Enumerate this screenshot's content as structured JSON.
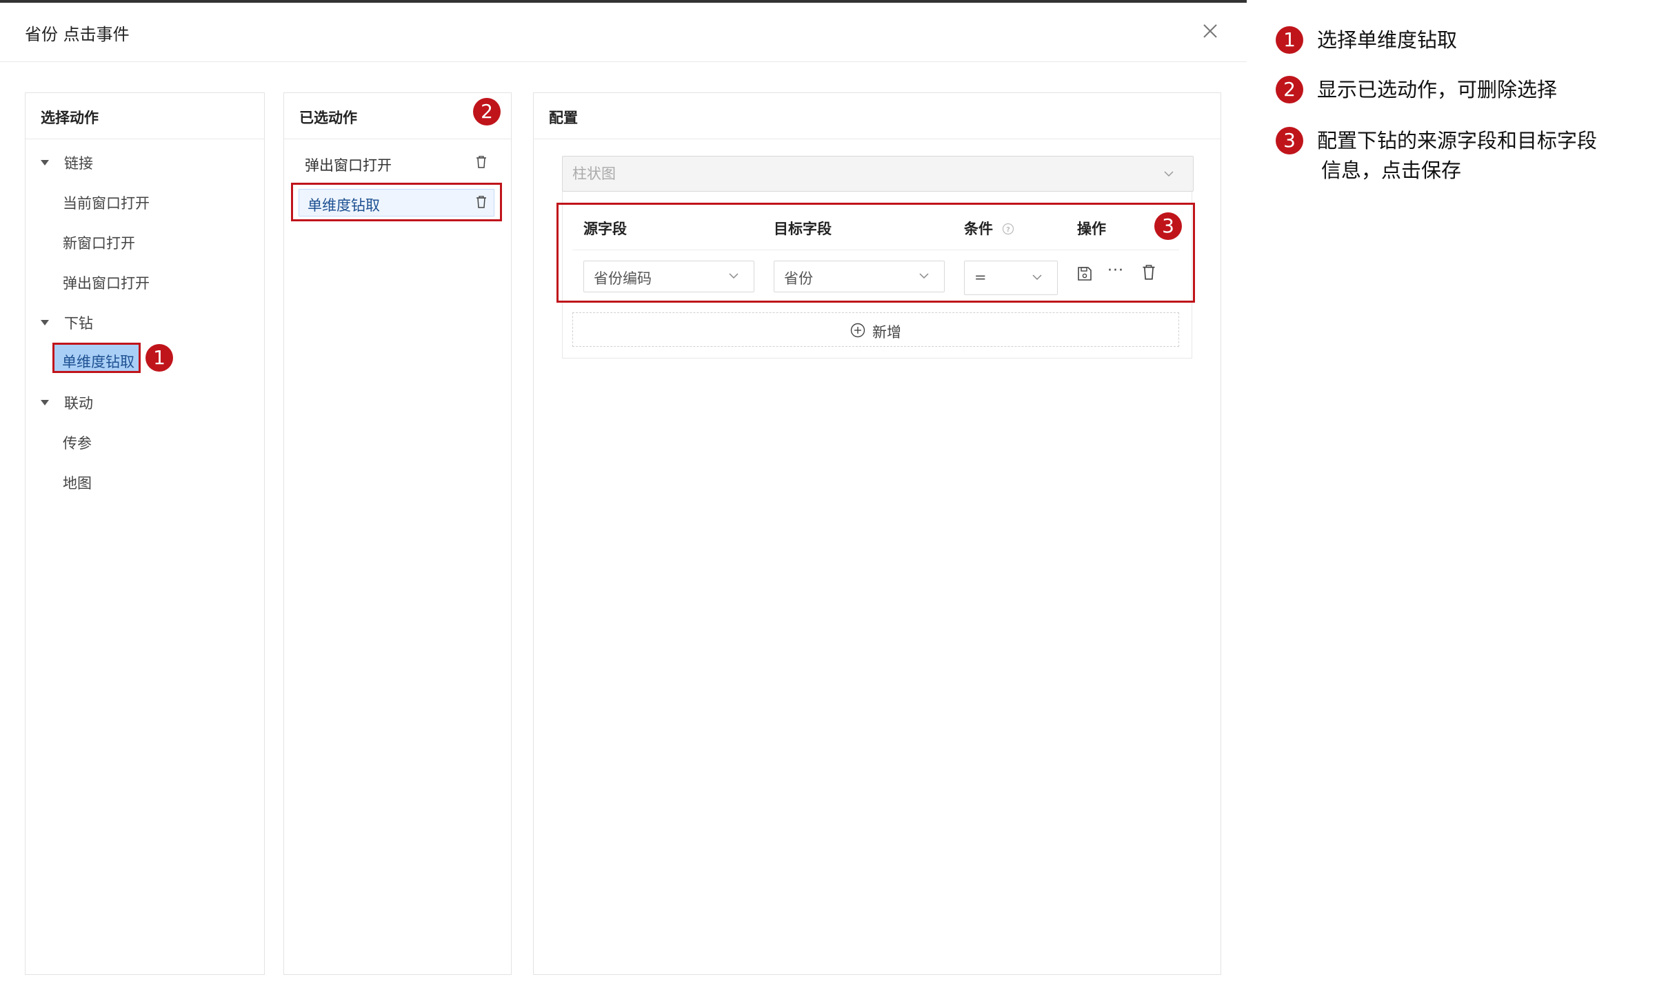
{
  "dialog": {
    "title": "省份 点击事件",
    "close_icon": "close-icon"
  },
  "panels": {
    "actions": {
      "title": "选择动作",
      "groups": [
        {
          "label": "链接",
          "items": [
            "当前窗口打开",
            "新窗口打开",
            "弹出窗口打开"
          ]
        },
        {
          "label": "下钻",
          "items": [
            "单维度钻取"
          ]
        },
        {
          "label": "联动",
          "items": [
            "传参",
            "地图"
          ]
        }
      ],
      "selected": "单维度钻取"
    },
    "selected": {
      "title": "已选动作",
      "items": [
        "弹出窗口打开",
        "单维度钻取"
      ],
      "active": "单维度钻取"
    },
    "config": {
      "title": "配置",
      "chart_select": {
        "value": "柱状图"
      },
      "columns": {
        "source": "源字段",
        "target": "目标字段",
        "condition": "条件",
        "actions": "操作"
      },
      "row": {
        "source": "省份编码",
        "target": "省份",
        "condition": "=",
        "more": "···"
      },
      "add_label": "新增"
    }
  },
  "badges": [
    "1",
    "2",
    "3"
  ],
  "notes": [
    {
      "num": "1",
      "text": "选择单维度钻取"
    },
    {
      "num": "2",
      "text": "显示已选动作，可删除选择"
    },
    {
      "num": "3",
      "text": "配置下钻的来源字段和目标字段",
      "text2": "信息，点击保存"
    }
  ],
  "colors": {
    "accent_red": "#c0141b",
    "selected_bg": "#a9cff6",
    "link_blue": "#1d4f91"
  }
}
